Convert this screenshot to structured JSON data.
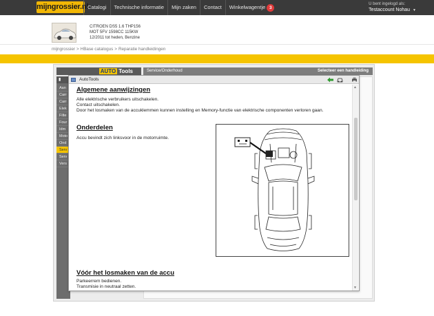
{
  "header": {
    "logo": "mijngrossier.nl",
    "nav": [
      "Catalogi",
      "Technische informatie",
      "Mijn zaken",
      "Contact"
    ],
    "cart": {
      "label": "Winkelwagentje",
      "count": "3"
    },
    "user": {
      "status": "U bent ingelogd als:",
      "name": "Testaccount Nohau"
    }
  },
  "vehicle": {
    "lines": [
      "CITROEN DS5 1.6 THP156",
      "MOT 5FV 1598CC 115KW",
      "12/2011 tot heden, Benzine"
    ]
  },
  "breadcrumb": [
    "mijngrossier",
    "HBase catalogus",
    "Reparatie handleidingen"
  ],
  "app": {
    "logo_prefix": "AUTO",
    "logo_suffix": "Tools",
    "service_header": "Service/Onderhoud",
    "service_right": "Selecteer een handleiding",
    "sidebar_items": [
      "Aan",
      "Carr",
      "Carr",
      "Elek",
      "Filte",
      "Four",
      "Idm",
      "Moto",
      "Ond",
      "Serv",
      "Serv",
      "Vers"
    ],
    "sidebar_active_index": 9
  },
  "modal": {
    "title": "AutoTools",
    "sections": [
      {
        "heading": "Algemene aanwijzingen",
        "lines": [
          "Alle elektrische verbruikers uitschakelen.",
          "Contact uitschakelen.",
          "Door het losmaken van de accuklemmen kunnen instelling en Memory-functie van elektrische componenten verloren gaan."
        ]
      },
      {
        "heading": "Onderdelen",
        "lines": [
          "Accu bevindt zich linksvoor in de motorruimte."
        ]
      },
      {
        "heading": "Vóór het losmaken van de accu",
        "lines": [
          "Parkeerrem bedienen.",
          "Transmisie in neutraal zetten."
        ]
      }
    ]
  },
  "colors": {
    "accent": "#f5c400",
    "topbar": "#3a3a3a",
    "badge": "#e03a3a"
  },
  "icons": [
    "back-arrow-icon",
    "car-icon",
    "print-icon"
  ]
}
